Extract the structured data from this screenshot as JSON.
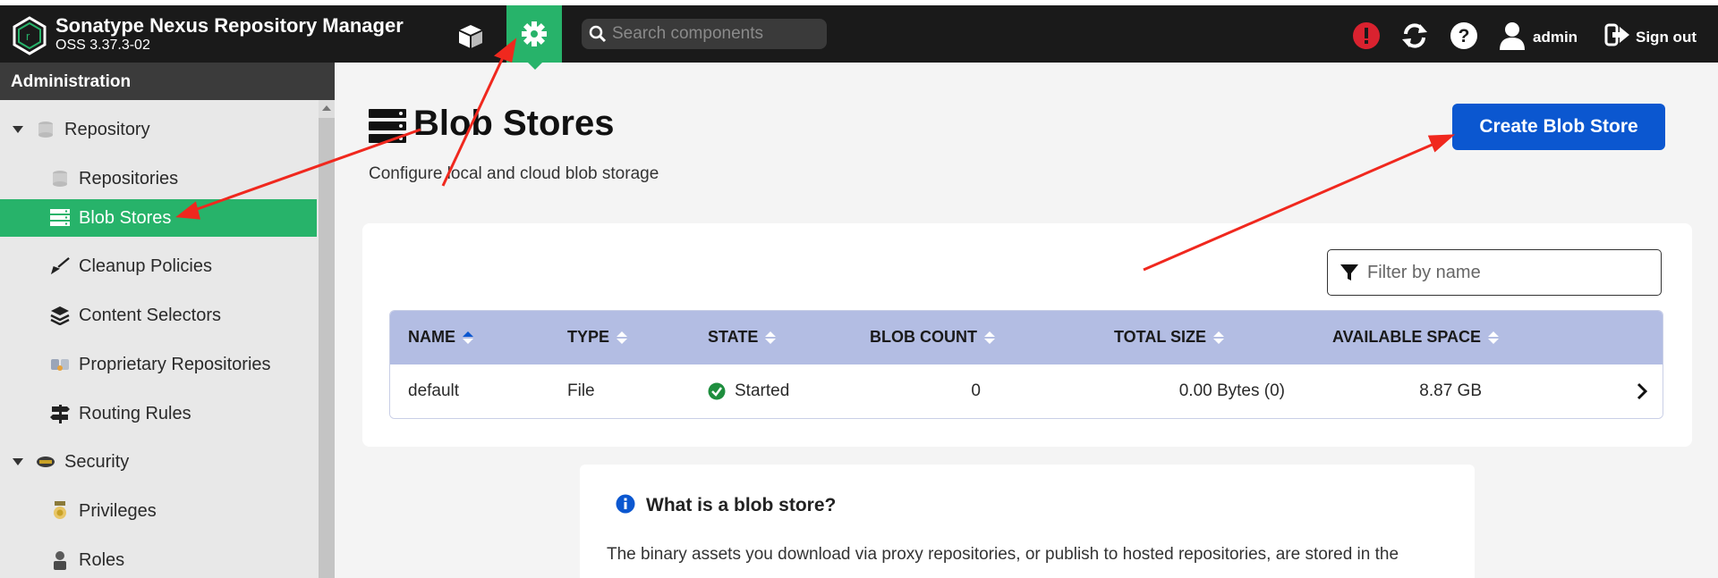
{
  "header": {
    "title": "Sonatype Nexus Repository Manager",
    "version": "OSS 3.37.3-02",
    "search_placeholder": "Search components",
    "user": "admin",
    "signout": "Sign out"
  },
  "sidebar": {
    "header": "Administration",
    "items": [
      {
        "label": "Repository"
      },
      {
        "label": "Repositories"
      },
      {
        "label": "Blob Stores"
      },
      {
        "label": "Cleanup Policies"
      },
      {
        "label": "Content Selectors"
      },
      {
        "label": "Proprietary Repositories"
      },
      {
        "label": "Routing Rules"
      },
      {
        "label": "Security"
      },
      {
        "label": "Privileges"
      },
      {
        "label": "Roles"
      }
    ]
  },
  "main": {
    "title": "Blob Stores",
    "subtitle": "Configure local and cloud blob storage",
    "create_label": "Create Blob Store",
    "filter_placeholder": "Filter by name",
    "columns": [
      "NAME",
      "TYPE",
      "STATE",
      "BLOB COUNT",
      "TOTAL SIZE",
      "AVAILABLE SPACE"
    ],
    "rows": [
      {
        "name": "default",
        "type": "File",
        "state": "Started",
        "blob_count": "0",
        "total_size": "0.00 Bytes (0)",
        "available_space": "8.87 GB"
      }
    ]
  },
  "info": {
    "title": "What is a blob store?",
    "body": "The binary assets you download via proxy repositories, or publish to hosted repositories, are stored in the"
  },
  "colors": {
    "accent_green": "#27b36a",
    "primary_blue": "#0b57d0",
    "table_header": "#b3bde3",
    "alert_red": "#d9222f",
    "annotation_red": "#f0281e"
  }
}
